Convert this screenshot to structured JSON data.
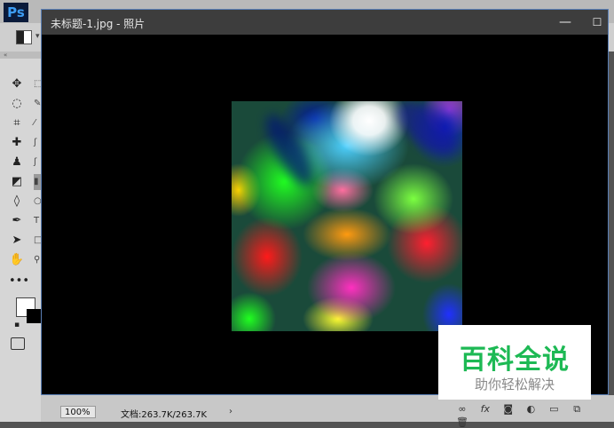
{
  "app": {
    "logo": "Ps"
  },
  "document": {
    "title": "未标题-1.jpg - 照片",
    "minimize_label": "—",
    "maximize_label": "☐"
  },
  "statusbar": {
    "zoom": "100%",
    "doc_info": "文档:263.7K/263.7K",
    "arrow": "›"
  },
  "watermark": {
    "title": "百科全说",
    "subtitle": "助你轻松解决"
  },
  "colors": {
    "foreground": "#ffffff",
    "background": "#000000"
  }
}
